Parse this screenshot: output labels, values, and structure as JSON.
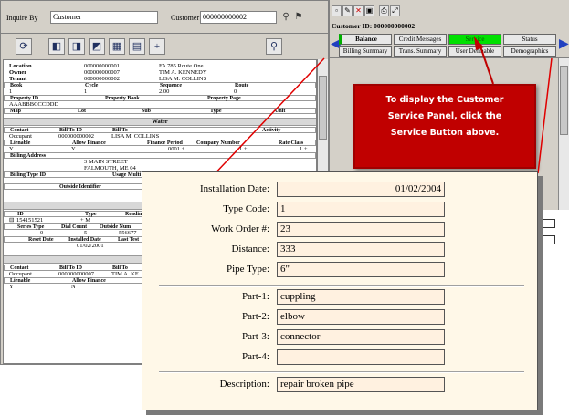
{
  "left": {
    "inquire_label": "Inquire By",
    "inquire_value": "Customer",
    "customer_label": "Customer",
    "customer_value": "000000000002"
  },
  "details": {
    "location_label": "Location",
    "location_id": "000000000001",
    "location_addr": "FA 785 Route One",
    "owner_label": "Owner",
    "owner_id": "000000000007",
    "owner_name": "TIM A. KENNEDY",
    "tenant_label": "Tenant",
    "tenant_id": "000000000002",
    "tenant_name": "LISA M. COLLINS",
    "book_h": "Book",
    "cycle_h": "Cycle",
    "sequence_h": "Sequence",
    "route_h": "Route",
    "book_v": "1",
    "cycle_v": "1",
    "sequence_v": "2.00",
    "route_v": "0",
    "propid_h": "Property ID",
    "propbook_h": "Property Book",
    "proppage_h": "Property Page",
    "propid_v": "AAABBBCCCDDD",
    "map_h": "Map",
    "lot_h": "Lot",
    "sub_h": "Sub",
    "type_h": "Type",
    "unit_h": "Unit",
    "water_h": "Water",
    "contact_h": "Contact",
    "billto_id_h": "Bill To ID",
    "billto_h": "Bill To",
    "activity_h": "Activity",
    "occupant": "Occupant",
    "occ_id": "000000000002",
    "occ_name": "LISA M. COLLINS",
    "lienable_h": "Lienable",
    "allow_finance_h": "Allow Finance",
    "finance_period_h": "Finance Period",
    "company_number_h": "Company Number",
    "rate_class_h": "Rate Class",
    "lien_v": "Y",
    "allow_v": "Y",
    "fin_v": "0001 +",
    "comp_v": "1 +",
    "rate_v": "1 +",
    "billing_addr_h": "Billing Address",
    "addr1": "3 MAIN STREET",
    "addr2": "FALMOUTH, ME 04",
    "billing_type_h": "Billing Type ID",
    "usage_mult_h": "Usage Multi",
    "outside_id_h": "Outside Identifier",
    "id_h": "ID",
    "type_col_h": "Type",
    "reading_h": "Readin",
    "meter_id": "154151521",
    "meter_type": "+ M",
    "series_type_h": "Series Type",
    "dial_count_h": "Dial Count",
    "outside_num_h": "Outside Num",
    "series_v": "0",
    "dial_v": "5",
    "outside_v": "556677",
    "reset_date_h": "Reset Date",
    "installed_date_h": "Installed Date",
    "last_test_h": "Last Test",
    "installed_v": "01/02/2001",
    "contact2_h": "Contact",
    "billto_id2_h": "Bill To ID",
    "billto2_h": "Bill To",
    "occupant2": "Occupant",
    "occ2_id": "000000000007",
    "occ2_name": "TIM A. KE",
    "lienable2_h": "Lienable",
    "allow_finance2_h": "Allow Finance",
    "lien2_v": "Y",
    "allow2_v": "N"
  },
  "right": {
    "customer_id_line": "Customer ID: 000000000002",
    "tabs": {
      "balance": "Balance",
      "credit_messages": "Credit Messages",
      "service": "Service",
      "status": "Status",
      "billing_summary": "Billing Summary",
      "trans_summary": "Trans. Summary",
      "user_definable": "User Definable",
      "demographics": "Demographics"
    },
    "colors": {
      "service_active": "#00e000",
      "callout_bg": "#c00000"
    }
  },
  "callout": {
    "line1": "To display the Customer",
    "line2": "Service Panel, click the",
    "line3": "Service Button above."
  },
  "service_panel": {
    "installation_date_label": "Installation Date:",
    "installation_date": "01/02/2004",
    "type_code_label": "Type Code:",
    "type_code": "1",
    "work_order_label": "Work Order #:",
    "work_order": "23",
    "distance_label": "Distance:",
    "distance": "333",
    "pipe_type_label": "Pipe Type:",
    "pipe_type": "6\"",
    "part1_label": "Part-1:",
    "part1": "cuppling",
    "part2_label": "Part-2:",
    "part2": "elbow",
    "part3_label": "Part-3:",
    "part3": "connector",
    "part4_label": "Part-4:",
    "part4": "",
    "description_label": "Description:",
    "description": "repair broken pipe"
  }
}
